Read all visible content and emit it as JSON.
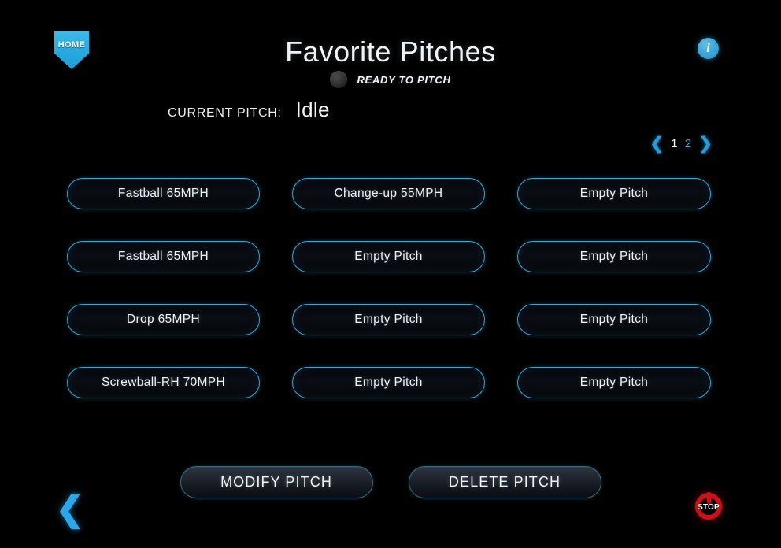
{
  "app": {
    "title": "Favorite Pitches",
    "background_color": "#000000",
    "accent_color": "#37a7d4"
  },
  "header": {
    "home_button": {
      "icon": "home-plate-icon",
      "label": "HOME"
    },
    "info_button": {
      "icon": "info-circle-icon",
      "glyph": "i"
    },
    "status": {
      "indicator": "status-lamp-off",
      "text": "READY TO PITCH",
      "indicator_color": "#343434"
    }
  },
  "current_pitch": {
    "label": "CURRENT PITCH:",
    "value": "Idle"
  },
  "pagination": {
    "prev_icon": "❮",
    "next_icon": "❯",
    "pages": [
      {
        "label": "1",
        "active": true
      },
      {
        "label": "2",
        "active": false
      }
    ]
  },
  "pitch_grid": {
    "rows": 4,
    "columns": 3,
    "buttons": [
      {
        "label": "Fastball 65MPH",
        "empty": false
      },
      {
        "label": "Change-up 55MPH",
        "empty": false
      },
      {
        "label": "Empty Pitch",
        "empty": true
      },
      {
        "label": "Fastball 65MPH",
        "empty": false
      },
      {
        "label": "Empty Pitch",
        "empty": true
      },
      {
        "label": "Empty Pitch",
        "empty": true
      },
      {
        "label": "Drop 65MPH",
        "empty": false
      },
      {
        "label": "Empty Pitch",
        "empty": true
      },
      {
        "label": "Empty Pitch",
        "empty": true
      },
      {
        "label": "Screwball-RH 70MPH",
        "empty": false
      },
      {
        "label": "Empty Pitch",
        "empty": true
      },
      {
        "label": "Empty Pitch",
        "empty": true
      }
    ]
  },
  "actions": {
    "modify_label": "MODIFY PITCH",
    "delete_label": "DELETE PITCH"
  },
  "footer": {
    "back_icon": "❮",
    "stop_button": {
      "icon": "power-stop-icon",
      "label": "STOP",
      "color": "#cc1118"
    }
  }
}
